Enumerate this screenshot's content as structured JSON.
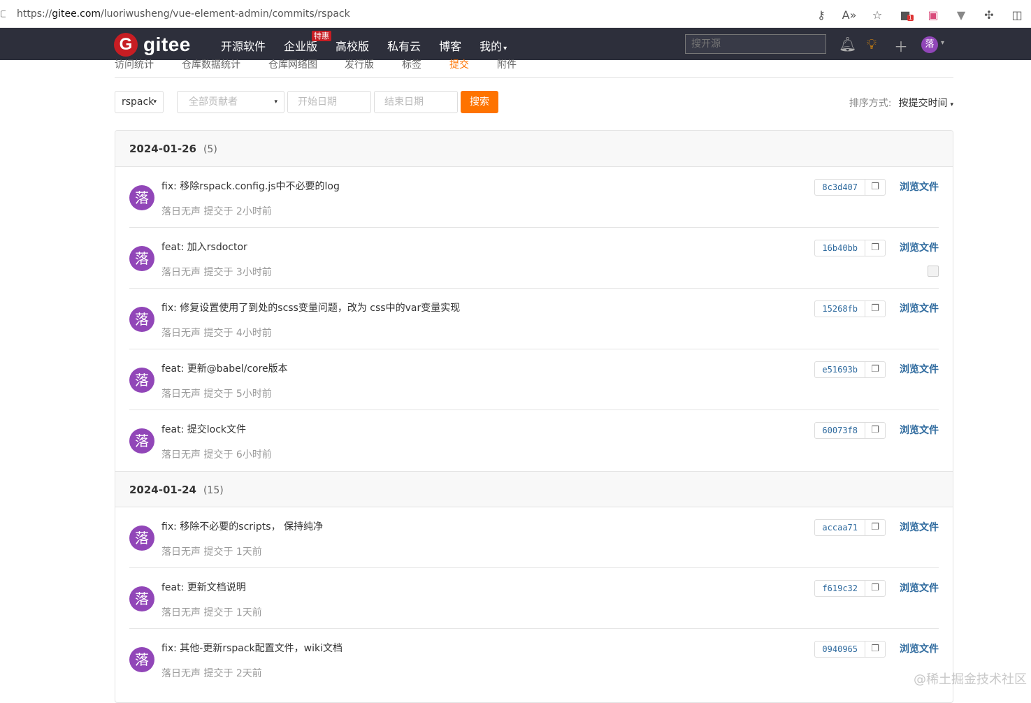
{
  "browser": {
    "url_prefix": "https://",
    "url_host": "gitee.com",
    "url_path": "/luoriwusheng/vue-element-admin/commits/rspack",
    "ext_badge": "1",
    "icons": [
      "key-icon",
      "read-aloud-icon",
      "favorite-star-icon",
      "extension-icon",
      "translate-icon",
      "vivaldi-icon",
      "puzzle-icon",
      "split-screen-icon"
    ]
  },
  "navbar": {
    "logo_mark": "G",
    "logo_text": "gitee",
    "links": [
      {
        "label": "开源软件"
      },
      {
        "label": "企业版",
        "badge": "特惠"
      },
      {
        "label": "高校版"
      },
      {
        "label": "私有云"
      },
      {
        "label": "博客"
      },
      {
        "label": "我的",
        "caret": "▾"
      }
    ],
    "search_placeholder": "搜开源",
    "avatar_text": "落",
    "avatar_caret": "▾"
  },
  "subnav": {
    "items": [
      {
        "label": "访问统计"
      },
      {
        "label": "仓库数据统计"
      },
      {
        "label": "仓库网络图"
      },
      {
        "label": "发行版"
      },
      {
        "label": "标签"
      },
      {
        "label": "提交",
        "active": true
      },
      {
        "label": "附件"
      }
    ]
  },
  "filters": {
    "branch": "rspack",
    "branch_caret": "▾",
    "contributor_placeholder": "全部贡献者",
    "contributor_caret": "▾",
    "start_date_placeholder": "开始日期",
    "end_date_placeholder": "结束日期",
    "search_button": "搜索",
    "sort_label": "排序方式:",
    "sort_value": "按提交时间",
    "sort_caret": "▾"
  },
  "groups": [
    {
      "date": "2024-01-26",
      "count": "(5)",
      "commits": [
        {
          "avatar": "落",
          "message": "fix: 移除rspack.config.js中不必要的log",
          "author": "落日无声",
          "time": "提交于 2小时前",
          "sha": "8c3d407",
          "browse": "浏览文件",
          "checkbox": false
        },
        {
          "avatar": "落",
          "message": "feat: 加入rsdoctor",
          "author": "落日无声",
          "time": "提交于 3小时前",
          "sha": "16b40bb",
          "browse": "浏览文件",
          "checkbox": true
        },
        {
          "avatar": "落",
          "message": "fix: 修复设置使用了到处的scss变量问题，改为 css中的var变量实现",
          "author": "落日无声",
          "time": "提交于 4小时前",
          "sha": "15268fb",
          "browse": "浏览文件",
          "checkbox": false
        },
        {
          "avatar": "落",
          "message": "feat: 更新@babel/core版本",
          "author": "落日无声",
          "time": "提交于 5小时前",
          "sha": "e51693b",
          "browse": "浏览文件",
          "checkbox": false
        },
        {
          "avatar": "落",
          "message": "feat: 提交lock文件",
          "author": "落日无声",
          "time": "提交于 6小时前",
          "sha": "60073f8",
          "browse": "浏览文件",
          "checkbox": false
        }
      ]
    },
    {
      "date": "2024-01-24",
      "count": "(15)",
      "commits": [
        {
          "avatar": "落",
          "message": "fix: 移除不必要的scripts， 保持纯净",
          "author": "落日无声",
          "time": "提交于 1天前",
          "sha": "accaa71",
          "browse": "浏览文件",
          "checkbox": false
        },
        {
          "avatar": "落",
          "message": "feat: 更新文档说明",
          "author": "落日无声",
          "time": "提交于 1天前",
          "sha": "f619c32",
          "browse": "浏览文件",
          "checkbox": false
        },
        {
          "avatar": "落",
          "message": "fix: 其他-更新rspack配置文件，wiki文档",
          "author": "落日无声",
          "time": "提交于 2天前",
          "sha": "0940965",
          "browse": "浏览文件",
          "checkbox": false
        }
      ]
    }
  ],
  "watermark": "@稀土掘金技术社区",
  "colors": {
    "nav_bg": "#2d2f3b",
    "brand_red": "#c71d23",
    "accent_orange": "#fe7300",
    "link_blue": "#2e6a9e",
    "avatar_purple": "#9146b8"
  }
}
